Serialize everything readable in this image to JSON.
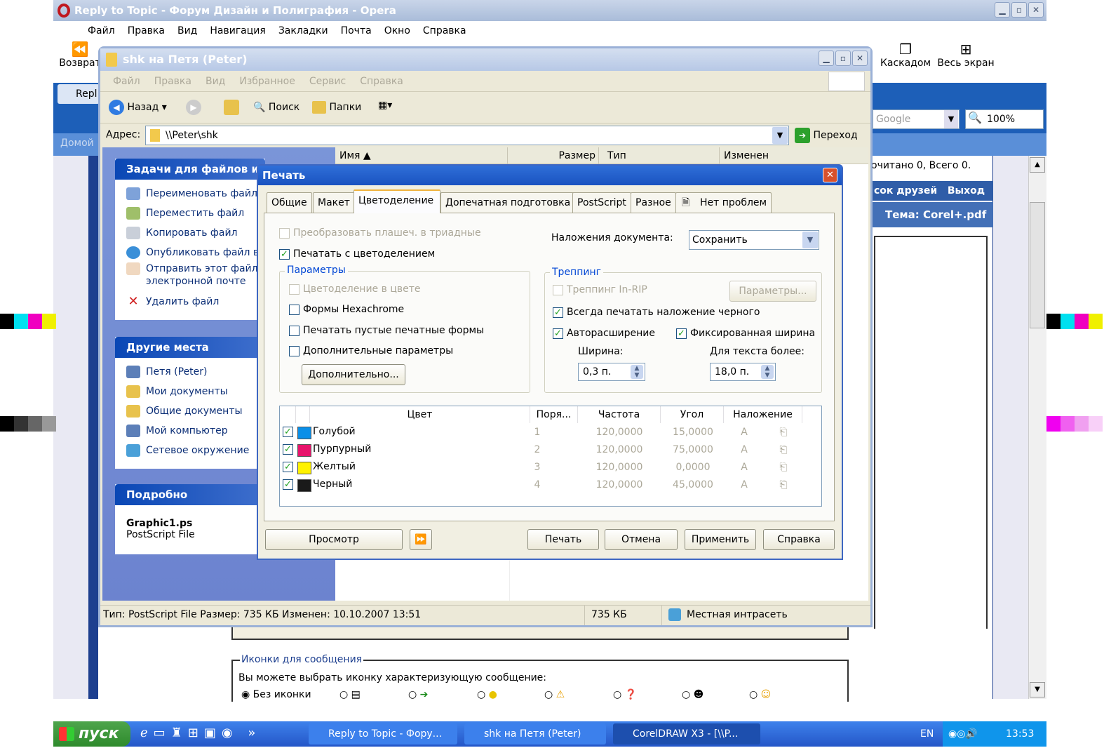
{
  "opera": {
    "title": "Reply to Topic - Форум Дизайн и Полиграфия - Opera",
    "menu": [
      "Файл",
      "Правка",
      "Вид",
      "Навигация",
      "Закладки",
      "Почта",
      "Окно",
      "Справка"
    ],
    "toolbar": {
      "back": "Возврат",
      "cascade": "Каскадом",
      "fullscreen": "Весь экран"
    },
    "tab_label": "Repl",
    "search_placeholder": "Google",
    "zoom": "100%",
    "home_label": "Домой",
    "forum_read": "очитано 0, Всего 0.",
    "forum_friends": "сок друзей",
    "forum_exit": "Выход",
    "forum_topic": "Тема: Corel+.pdf",
    "icons_legend": "Иконки для сообщения",
    "icons_hint": "Вы можете выбрать иконку характеризующую сообщение:",
    "no_icon": "Без иконки"
  },
  "explorer": {
    "title": "shk на Петя (Peter)",
    "menu": [
      "Файл",
      "Правка",
      "Вид",
      "Избранное",
      "Сервис",
      "Справка"
    ],
    "toolbar": {
      "back": "Назад",
      "search": "Поиск",
      "folders": "Папки"
    },
    "address_label": "Адрес:",
    "address_value": "\\\\Peter\\shk",
    "go_label": "Переход",
    "columns": [
      "Имя",
      "Размер",
      "Тип",
      "Изменен"
    ],
    "tasks_title": "Задачи для файлов и п",
    "tasks": [
      "Переименовать файл",
      "Переместить файл",
      "Копировать файл",
      "Опубликовать файл в",
      "Отправить этот файл электронной почте",
      "Удалить файл"
    ],
    "places_title": "Другие места",
    "places": [
      "Петя (Peter)",
      "Мои документы",
      "Общие документы",
      "Мой компьютер",
      "Сетевое окружение"
    ],
    "details_title": "Подробно",
    "details_name": "Graphic1.ps",
    "details_type": "PostScript File",
    "status_left": "Тип: PostScript File Размер: 735 КБ Изменен: 10.10.2007 13:51",
    "status_size": "735 КБ",
    "status_zone": "Местная интрасеть"
  },
  "print": {
    "title": "Печать",
    "tabs": [
      "Общие",
      "Макет",
      "Цветоделение",
      "Допечатная подготовка",
      "PostScript",
      "Разное",
      "Нет проблем"
    ],
    "convert_spot": "Преобразовать плашеч. в триадные",
    "print_separations": "Печатать с цветоделением",
    "overprint_label": "Наложения документа:",
    "overprint_value": "Сохранить",
    "params_group": "Параметры",
    "sep_in_color": "Цветоделение в цвете",
    "hexachrome": "Формы Hexachrome",
    "print_empty": "Печатать пустые печатные формы",
    "advanced_params": "Дополнительные параметры",
    "advanced_button": "Дополнительно...",
    "trapping_group": "Треппинг",
    "in_rip": "Треппинг In-RIP",
    "trap_params_button": "Параметры...",
    "always_black": "Всегда печатать наложение черного",
    "autospread": "Авторасширение",
    "fixed_width": "Фиксированная ширина",
    "width_label": "Ширина:",
    "width_value": "0,3 п.",
    "text_above_label": "Для текста более:",
    "text_above_value": "18,0 п.",
    "table_headers": [
      "Цвет",
      "Поря...",
      "Частота",
      "Угол",
      "Наложение"
    ],
    "colors": [
      {
        "name": "Голубой",
        "order": "1",
        "freq": "120,0000",
        "angle": "15,0000",
        "swatch": "#0a8fe8"
      },
      {
        "name": "Пурпурный",
        "order": "2",
        "freq": "120,0000",
        "angle": "75,0000",
        "swatch": "#e8146c"
      },
      {
        "name": "Желтый",
        "order": "3",
        "freq": "120,0000",
        "angle": "0,0000",
        "swatch": "#fff200"
      },
      {
        "name": "Черный",
        "order": "4",
        "freq": "120,0000",
        "angle": "45,0000",
        "swatch": "#1a1a1a"
      }
    ],
    "buttons": {
      "preview": "Просмотр",
      "print": "Печать",
      "cancel": "Отмена",
      "apply": "Применить",
      "help": "Справка"
    }
  },
  "taskbar": {
    "start": "пуск",
    "tasks": [
      "Reply to Topic - Фору...",
      "shk на Петя (Peter)",
      "CorelDRAW X3 - [\\\\P..."
    ],
    "lang": "EN",
    "clock": "13:53"
  }
}
